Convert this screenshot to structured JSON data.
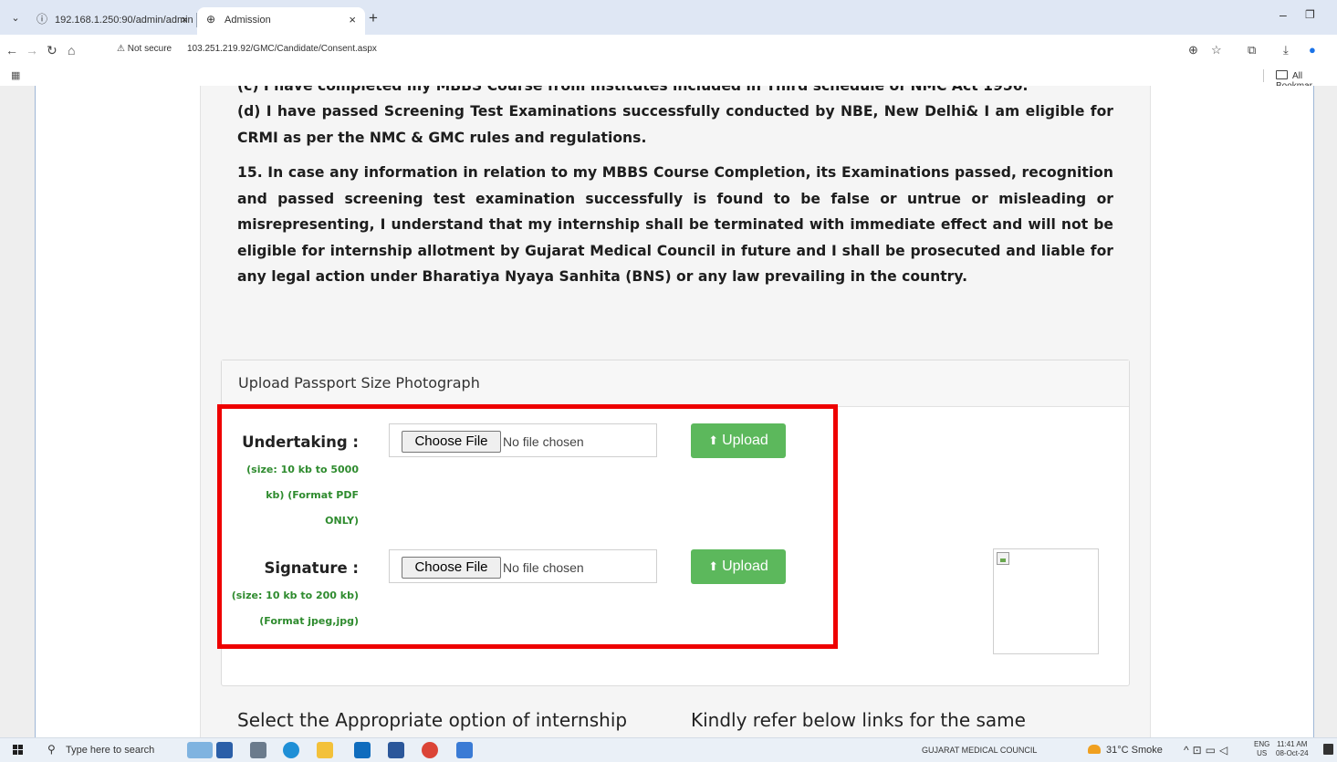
{
  "browser": {
    "tabs": [
      {
        "label": "192.168.1.250:90/admin/admin",
        "active": false
      },
      {
        "label": "Admission",
        "active": true
      }
    ],
    "new_tab_label": "+",
    "url_security": "Not secure",
    "url": "103.251.219.92/GMC/Candidate/Consent.aspx",
    "all_bookmarks_label": "All Bookmar"
  },
  "content": {
    "clause_c": "(c) I have completed my MBBS Course from Institutes included in Third schedule of NMC Act 1956.",
    "clause_d": "(d) I have passed Screening Test Examinations successfully conducted by NBE, New Delhi& I am eligible for CRMI as per the NMC & GMC rules and regulations.",
    "clause_15": "15. In case any information in relation to my MBBS Course Completion, its Examinations passed, recognition and passed screening test examination successfully is found to be false or untrue or misleading or misrepresenting, I understand that my internship shall be terminated with immediate effect and will not be eligible for internship allotment by Gujarat Medical Council in future and I shall be prosecuted and liable for any legal action under Bharatiya Nyaya Sanhita (BNS) or any law prevailing in the country."
  },
  "upload_card": {
    "header": "Upload Passport Size Photograph",
    "undertaking": {
      "label": "Undertaking :",
      "hint_lines": [
        "(size: 10 kb to 5000",
        "kb) (Format PDF",
        "ONLY)"
      ],
      "choose_label": "Choose File",
      "no_file_text": "No file chosen",
      "upload_label": "Upload"
    },
    "signature": {
      "label": "Signature :",
      "hint_lines": [
        "(size: 10 kb to 200 kb)",
        "(Format jpeg,jpg)"
      ],
      "choose_label": "Choose File",
      "no_file_text": "No file chosen",
      "upload_label": "Upload"
    }
  },
  "bottom": {
    "left_heading": "Select the Appropriate option of internship",
    "right_heading": "Kindly refer below links for the same"
  },
  "taskbar": {
    "search_placeholder": "Type here to search",
    "caption": "GUJARAT MEDICAL COUNCIL",
    "weather": "31°C  Smoke",
    "lang_top": "ENG",
    "lang_bottom": "US",
    "time": "11:41 AM",
    "date": "08-Oct-24"
  },
  "colors": {
    "upload_button": "#5cb85c",
    "hint_text": "#2e8b2e",
    "highlight_box": "#ee0000"
  }
}
